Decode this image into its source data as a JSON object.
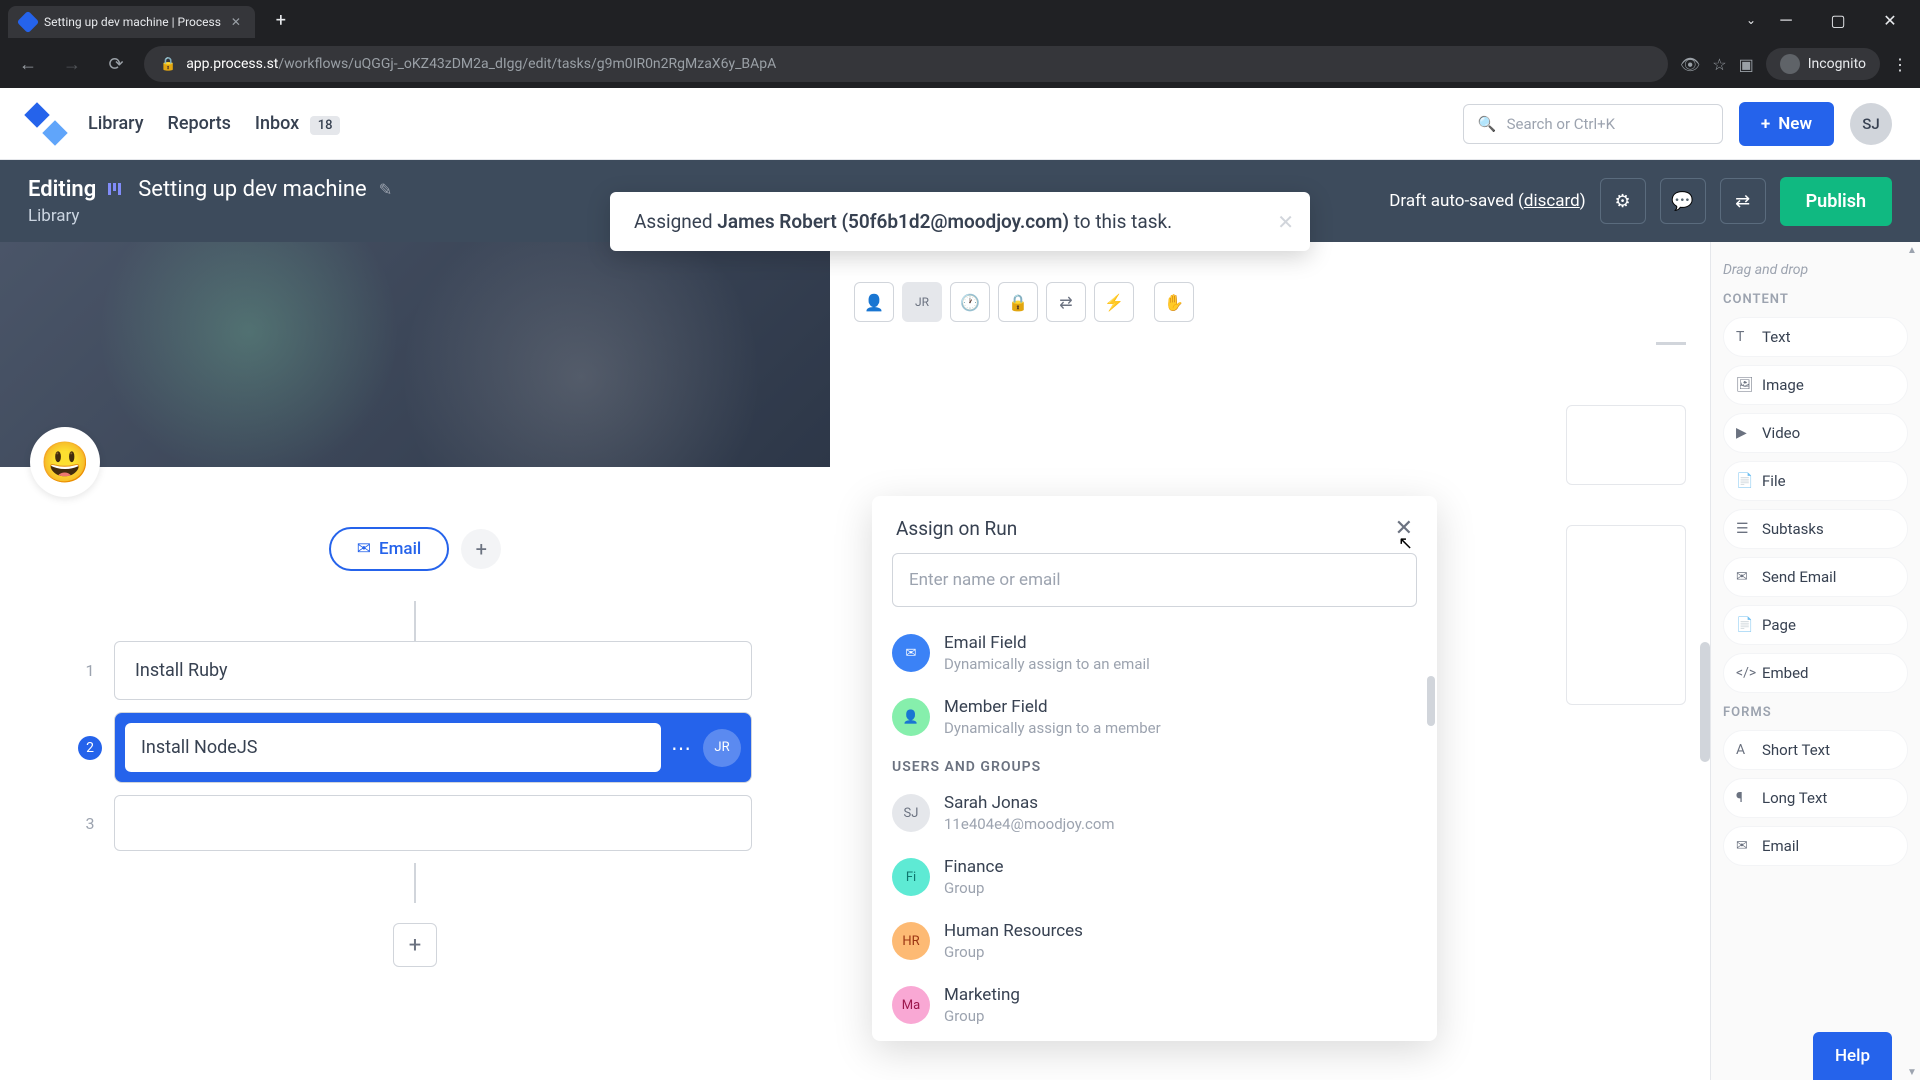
{
  "browser": {
    "tab_title": "Setting up dev machine | Process",
    "url_domain": "app.process.st",
    "url_path": "/workflows/uQGGj-_oKZ43zDM2a_dIgg/edit/tasks/g9m0IR0n2RgMzaX6y_BApA",
    "incognito_label": "Incognito"
  },
  "header": {
    "nav": {
      "library": "Library",
      "reports": "Reports",
      "inbox": "Inbox",
      "inbox_count": "18"
    },
    "search_placeholder": "Search or Ctrl+K",
    "new_button": "New",
    "user_initials": "SJ"
  },
  "editing_bar": {
    "label": "Editing",
    "workflow_title": "Setting up dev machine",
    "breadcrumb": "Library",
    "draft_text": "Draft auto-saved",
    "discard": "discard",
    "publish": "Publish"
  },
  "toast": {
    "prefix": "Assigned ",
    "name": "James Robert (50f6b1d2@moodjoy.com)",
    "suffix": " to this task."
  },
  "left": {
    "emoji": "😃",
    "email_label": "Email",
    "tasks": {
      "t1_num": "1",
      "t1_label": "Install Ruby",
      "t2_num": "2",
      "t2_label": "Install NodeJS",
      "t2_avatar": "JR",
      "t3_num": "3"
    }
  },
  "editor_toolbar": {
    "avatar": "JR"
  },
  "assign_popover": {
    "title": "Assign on Run",
    "input_placeholder": "Enter name or email",
    "email_field_title": "Email Field",
    "email_field_sub": "Dynamically assign to an email",
    "member_field_title": "Member Field",
    "member_field_sub": "Dynamically assign to a member",
    "section_users": "USERS AND GROUPS",
    "users": [
      {
        "initials": "SJ",
        "name": "Sarah Jonas",
        "sub": "11e404e4@moodjoy.com",
        "cls": "gray"
      },
      {
        "initials": "Fi",
        "name": "Finance",
        "sub": "Group",
        "cls": "teal"
      },
      {
        "initials": "HR",
        "name": "Human Resources",
        "sub": "Group",
        "cls": "orange"
      },
      {
        "initials": "Ma",
        "name": "Marketing",
        "sub": "Group",
        "cls": "pink"
      }
    ]
  },
  "sidebar": {
    "hint": "Drag and drop",
    "section_content": "CONTENT",
    "items": [
      {
        "label": "Text"
      },
      {
        "label": "Image"
      },
      {
        "label": "Video"
      },
      {
        "label": "File"
      },
      {
        "label": "Subtasks"
      },
      {
        "label": "Send Email"
      },
      {
        "label": "Page"
      },
      {
        "label": "Embed"
      }
    ],
    "section_forms": "FORMS",
    "forms": [
      {
        "label": "Short Text"
      },
      {
        "label": "Long Text"
      },
      {
        "label": "Email"
      }
    ]
  },
  "help": "Help"
}
